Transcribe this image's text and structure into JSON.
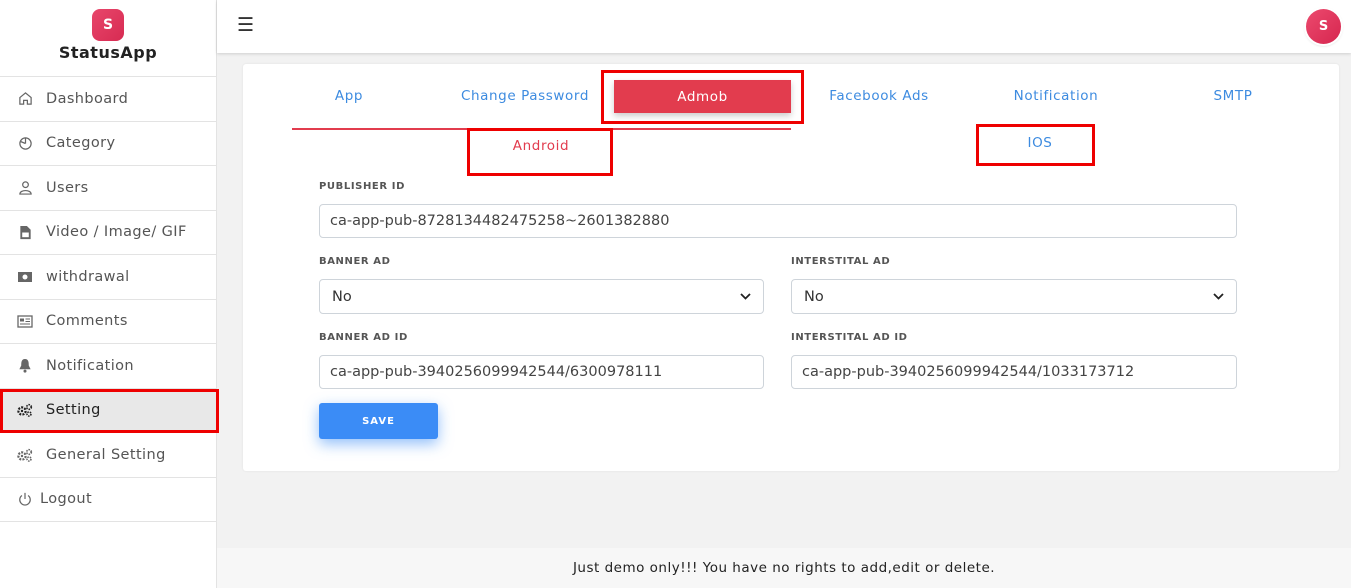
{
  "app": {
    "logo_text": "S",
    "name": "StatusApp"
  },
  "sidebar": {
    "items": [
      {
        "label": "Dashboard",
        "icon": "home-icon"
      },
      {
        "label": "Category",
        "icon": "clock-icon"
      },
      {
        "label": "Users",
        "icon": "user-icon"
      },
      {
        "label": "Video / Image/ GIF",
        "icon": "file-icon"
      },
      {
        "label": "withdrawal",
        "icon": "money-icon"
      },
      {
        "label": "Comments",
        "icon": "newspaper-icon"
      },
      {
        "label": "Notification",
        "icon": "bell-icon"
      },
      {
        "label": "Setting",
        "icon": "gears-icon",
        "active": true
      },
      {
        "label": "General Setting",
        "icon": "gears-icon"
      },
      {
        "label": "Logout",
        "icon": "power-icon"
      }
    ]
  },
  "topbar": {
    "menu_icon": "hamburger-icon",
    "avatar_text": "S"
  },
  "tabs": [
    "App",
    "Change Password",
    "Admob",
    "Facebook Ads",
    "Notification",
    "SMTP"
  ],
  "active_tab": "Admob",
  "subtabs": [
    "Android",
    "IOS"
  ],
  "active_subtab": "Android",
  "form": {
    "publisher_id_label": "PUBLISHER ID",
    "publisher_id_value": "ca-app-pub-8728134482475258~2601382880",
    "banner_ad_label": "BANNER AD",
    "banner_ad_value": "No",
    "interstitial_ad_label": "INTERSTITAL AD",
    "interstitial_ad_value": "No",
    "banner_ad_id_label": "BANNER AD ID",
    "banner_ad_id_value": "ca-app-pub-3940256099942544/6300978111",
    "interstitial_ad_id_label": "INTERSTITAL AD ID",
    "interstitial_ad_id_value": "ca-app-pub-3940256099942544/1033173712",
    "save_label": "SAVE"
  },
  "footer_text": "Just demo only!!! You have no rights to add,edit or delete.",
  "colors": {
    "accent_red": "#e23c4e",
    "link_blue": "#3d8be0",
    "save_blue": "#3b8cf6",
    "highlight": "#ee0000"
  }
}
